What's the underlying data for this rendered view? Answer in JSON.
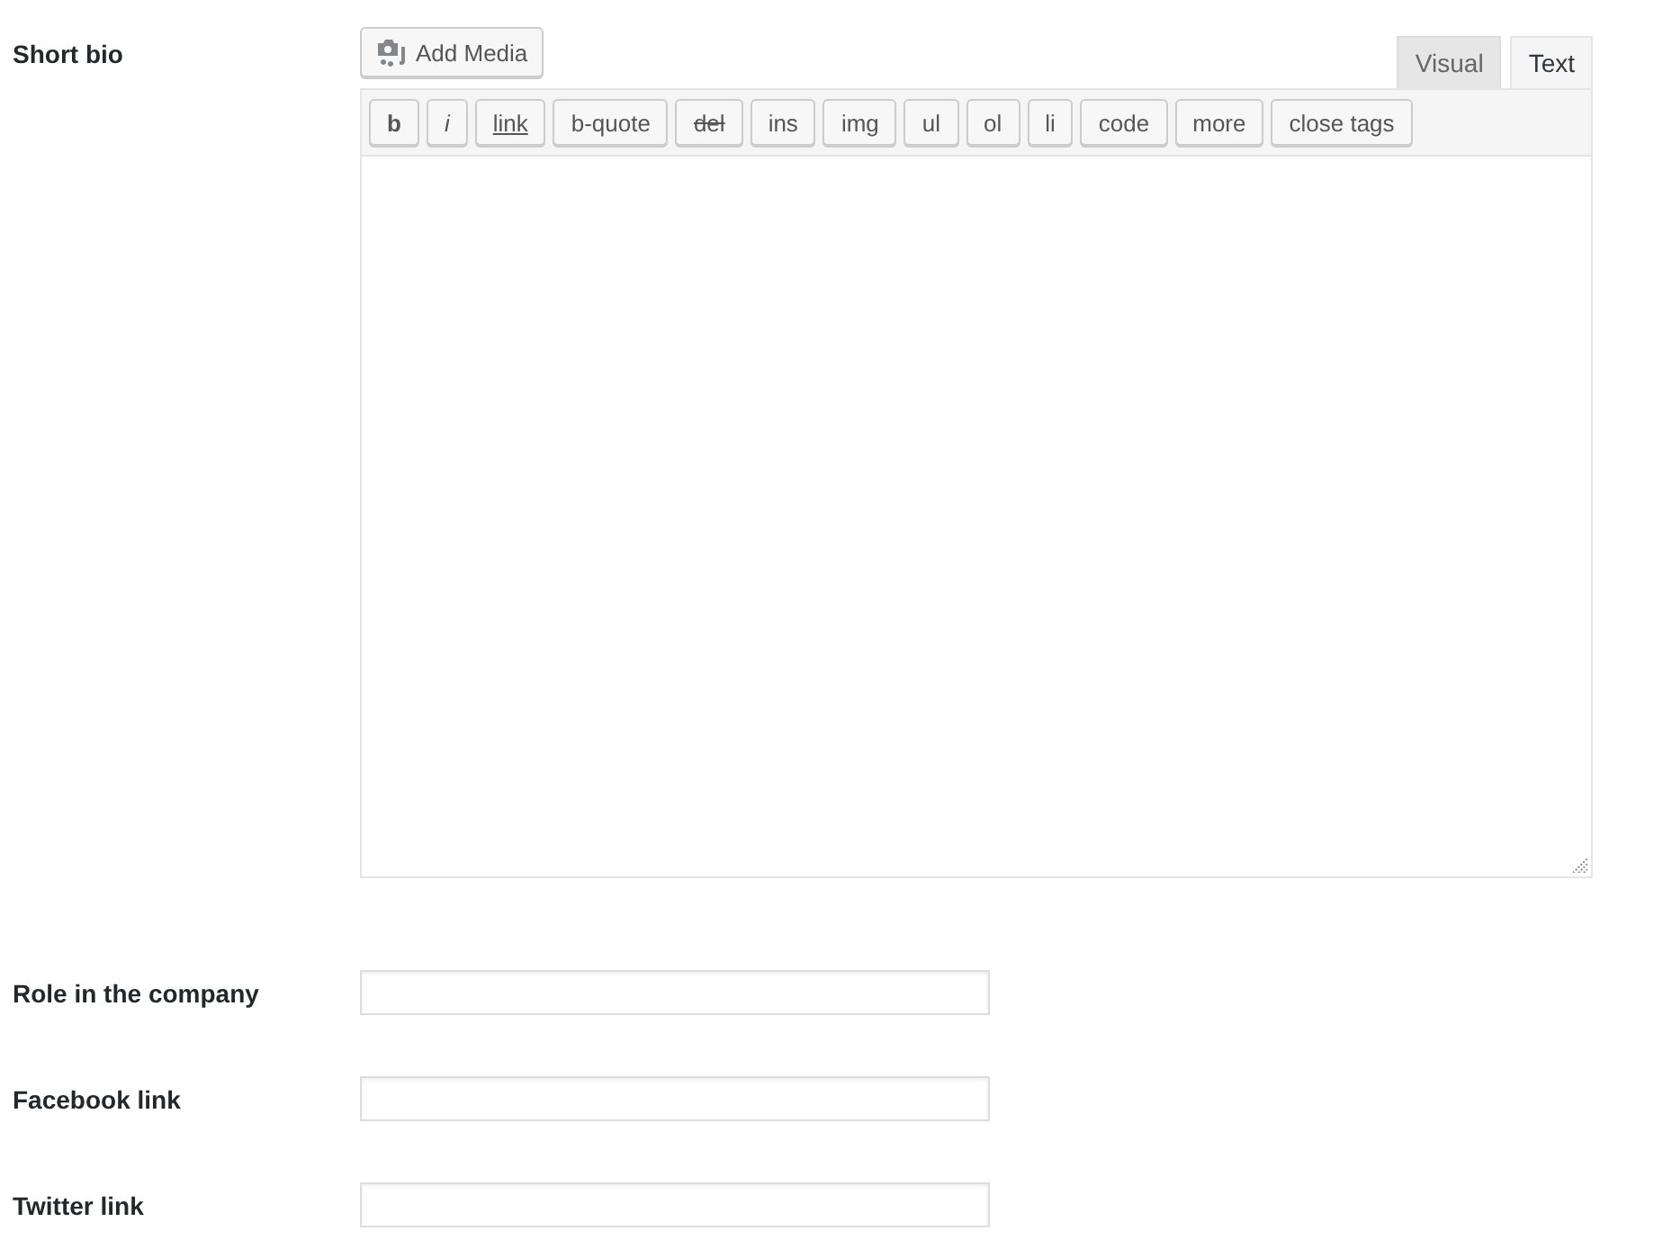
{
  "bio": {
    "label": "Short bio",
    "add_media": "Add Media",
    "tabs": [
      {
        "label": "Visual",
        "selected": false
      },
      {
        "label": "Text",
        "selected": true
      }
    ],
    "quicktags": [
      {
        "label": "b",
        "kind": "bold"
      },
      {
        "label": "i",
        "kind": "italic"
      },
      {
        "label": "link",
        "kind": "link"
      },
      {
        "label": "b-quote",
        "kind": "plain"
      },
      {
        "label": "del",
        "kind": "deleted"
      },
      {
        "label": "ins",
        "kind": "plain"
      },
      {
        "label": "img",
        "kind": "plain"
      },
      {
        "label": "ul",
        "kind": "plain"
      },
      {
        "label": "ol",
        "kind": "plain"
      },
      {
        "label": "li",
        "kind": "plain"
      },
      {
        "label": "code",
        "kind": "plain"
      },
      {
        "label": "more",
        "kind": "plain"
      },
      {
        "label": "close tags",
        "kind": "plain"
      }
    ]
  },
  "fields": [
    {
      "label": "Role in the company"
    },
    {
      "label": "Facebook link"
    },
    {
      "label": "Twitter link"
    }
  ]
}
